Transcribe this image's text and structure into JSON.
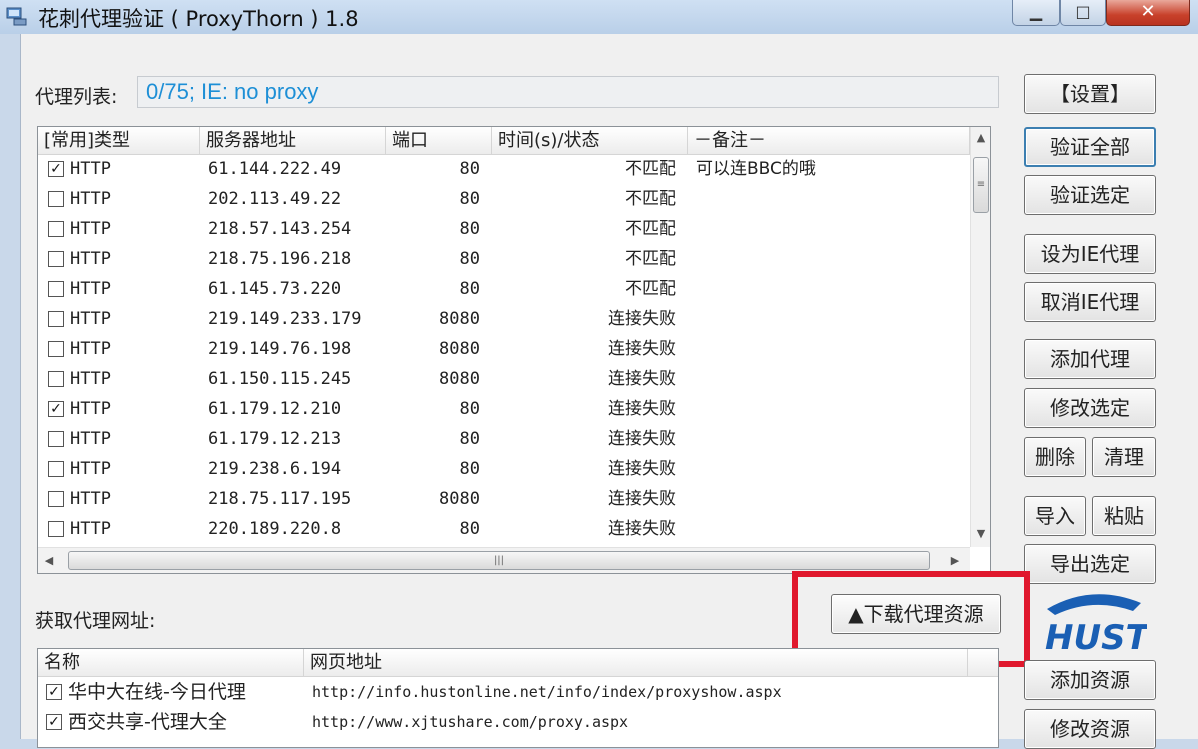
{
  "window": {
    "title": "花刺代理验证 ( ProxyThorn ) 1.8",
    "min_glyph": "▁",
    "max_glyph": "□",
    "close_glyph": "✕"
  },
  "proxy_list": {
    "label": "代理列表:",
    "status": "0/75;    IE: no proxy",
    "columns": [
      "[常用]类型",
      "服务器地址",
      "端口",
      "时间(s)/状态",
      "－备注－"
    ],
    "rows": [
      {
        "checked": true,
        "type": "HTTP",
        "address": "61.144.222.49",
        "port": "80",
        "status": "不匹配",
        "note": "可以连BBC的哦"
      },
      {
        "checked": false,
        "type": "HTTP",
        "address": "202.113.49.22",
        "port": "80",
        "status": "不匹配",
        "note": ""
      },
      {
        "checked": false,
        "type": "HTTP",
        "address": "218.57.143.254",
        "port": "80",
        "status": "不匹配",
        "note": ""
      },
      {
        "checked": false,
        "type": "HTTP",
        "address": "218.75.196.218",
        "port": "80",
        "status": "不匹配",
        "note": ""
      },
      {
        "checked": false,
        "type": "HTTP",
        "address": "61.145.73.220",
        "port": "80",
        "status": "不匹配",
        "note": ""
      },
      {
        "checked": false,
        "type": "HTTP",
        "address": "219.149.233.179",
        "port": "8080",
        "status": "连接失败",
        "note": ""
      },
      {
        "checked": false,
        "type": "HTTP",
        "address": "219.149.76.198",
        "port": "8080",
        "status": "连接失败",
        "note": ""
      },
      {
        "checked": false,
        "type": "HTTP",
        "address": "61.150.115.245",
        "port": "8080",
        "status": "连接失败",
        "note": ""
      },
      {
        "checked": true,
        "type": "HTTP",
        "address": "61.179.12.210",
        "port": "80",
        "status": "连接失败",
        "note": ""
      },
      {
        "checked": false,
        "type": "HTTP",
        "address": "61.179.12.213",
        "port": "80",
        "status": "连接失败",
        "note": ""
      },
      {
        "checked": false,
        "type": "HTTP",
        "address": "219.238.6.194",
        "port": "80",
        "status": "连接失败",
        "note": ""
      },
      {
        "checked": false,
        "type": "HTTP",
        "address": "218.75.117.195",
        "port": "8080",
        "status": "连接失败",
        "note": ""
      },
      {
        "checked": false,
        "type": "HTTP",
        "address": "220.189.220.8",
        "port": "80",
        "status": "连接失败",
        "note": ""
      }
    ]
  },
  "buttons": {
    "settings": "【设置】",
    "verify_all": "验证全部",
    "verify_selected": "验证选定",
    "set_ie_proxy": "设为IE代理",
    "cancel_ie_proxy": "取消IE代理",
    "add_proxy": "添加代理",
    "edit_selected": "修改选定",
    "delete": "删除",
    "clear": "清理",
    "import": "导入",
    "paste": "粘贴",
    "export_selected": "导出选定",
    "download_sources": "▲下载代理资源",
    "add_source": "添加资源",
    "edit_source": "修改资源"
  },
  "source_list": {
    "label": "获取代理网址:",
    "columns": [
      "名称",
      "网页地址"
    ],
    "rows": [
      {
        "checked": true,
        "name": "华中大在线-今日代理",
        "url": "http://info.hustonline.net/info/index/proxyshow.aspx"
      },
      {
        "checked": true,
        "name": "西交共享-代理大全",
        "url": "http://www.xjtushare.com/proxy.aspx"
      }
    ]
  },
  "colors": {
    "status_text": "#1d8fd6",
    "highlight_box": "#e0182d",
    "logo_blue": "#1a5fb4"
  },
  "icons": {
    "app": "app-icon",
    "checkbox_checked": "check-icon",
    "logo": "hust-logo"
  }
}
